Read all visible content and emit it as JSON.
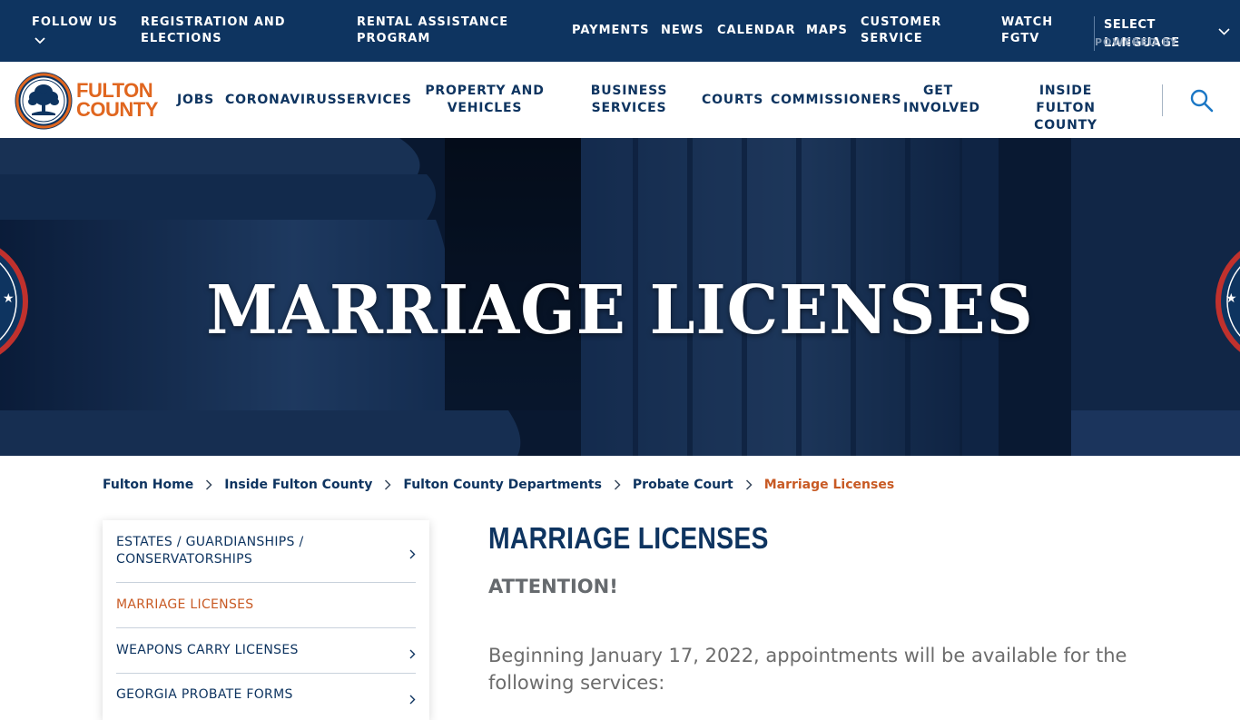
{
  "topbar": {
    "follow_us": "FOLLOW US",
    "links": [
      "REGISTRATION AND ELECTIONS",
      "RENTAL ASSISTANCE PROGRAM",
      "PAYMENTS",
      "NEWS",
      "CALENDAR",
      "MAPS",
      "CUSTOMER SERVICE",
      "WATCH FGTV"
    ],
    "language": {
      "select_label": "SELECT LANGUAGE",
      "powered_by": "POWERED BY"
    }
  },
  "logo": {
    "line1": "FULTON",
    "line2": "COUNTY"
  },
  "nav": {
    "items": [
      "JOBS",
      "CORONAVIRUS",
      "SERVICES",
      "PROPERTY AND VEHICLES",
      "BUSINESS SERVICES",
      "COURTS",
      "COMMISSIONERS",
      "GET INVOLVED",
      "INSIDE FULTON COUNTY"
    ]
  },
  "hero": {
    "title": "MARRIAGE LICENSES"
  },
  "breadcrumb": [
    "Fulton Home",
    "Inside Fulton County",
    "Fulton County Departments",
    "Probate Court",
    "Marriage Licenses"
  ],
  "sidebar": {
    "items": [
      {
        "label": "ESTATES / GUARDIANSHIPS / CONSERVATORSHIPS",
        "active": false
      },
      {
        "label": "MARRIAGE LICENSES",
        "active": true
      },
      {
        "label": "WEAPONS CARRY LICENSES",
        "active": false
      },
      {
        "label": "GEORGIA PROBATE FORMS",
        "active": false
      }
    ]
  },
  "content": {
    "title": "MARRIAGE LICENSES",
    "attention": "ATTENTION!",
    "paragraph": "Beginning January 17, 2022, appointments will be available for the following services:"
  },
  "colors": {
    "navy": "#0e3460",
    "orange": "#c85a24",
    "logo_orange": "#e0661f",
    "hero_dark": "#0b1d36"
  },
  "icons": [
    "chevron-down-icon",
    "search-icon",
    "chevron-right-icon",
    "tree-icon",
    "seal-icon"
  ]
}
